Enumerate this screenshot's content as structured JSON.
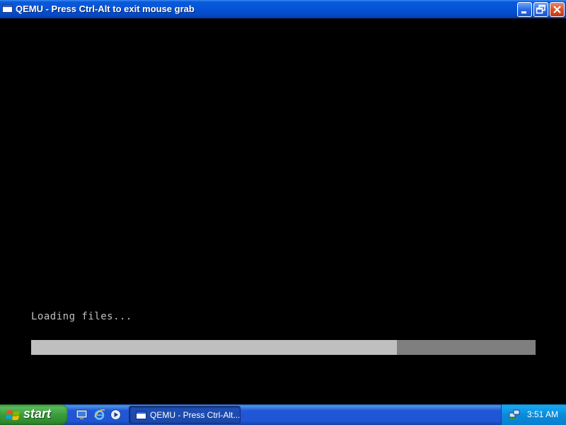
{
  "window": {
    "title": "QEMU - Press Ctrl-Alt to exit mouse grab",
    "icon": "qemu-window-icon",
    "buttons": {
      "minimize": "minimize-icon",
      "restore": "restore-icon",
      "close": "close-icon"
    }
  },
  "guest": {
    "status_text": "Loading files...",
    "progress_fraction": 0.725,
    "colors": {
      "background": "#000000",
      "text": "#c0c0c0",
      "bar_filled": "#bfbfbf",
      "bar_track": "#7f7f7f"
    }
  },
  "taskbar": {
    "start_label": "start",
    "quick_launch": [
      {
        "icon": "show-desktop-icon"
      },
      {
        "icon": "internet-explorer-icon"
      },
      {
        "icon": "media-player-icon"
      }
    ],
    "tasks": [
      {
        "label": "QEMU - Press Ctrl-Alt...",
        "icon": "qemu-window-icon"
      }
    ],
    "tray": {
      "icons": [
        "network-icon"
      ],
      "clock": "3:51 AM"
    }
  }
}
